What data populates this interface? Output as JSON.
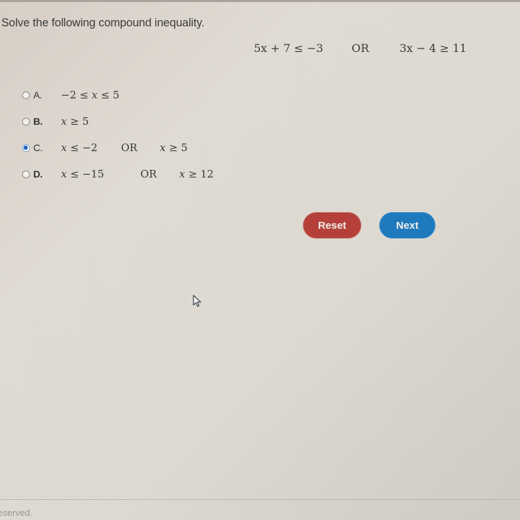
{
  "question": {
    "prompt": "Solve the following compound inequality.",
    "equation": {
      "left": "5x + 7 ≤ −3",
      "connector": "OR",
      "right": "3x − 4 ≥ 11"
    }
  },
  "options": [
    {
      "letter": "A.",
      "parts": [
        "−2 ≤ ",
        "x",
        " ≤ 5"
      ],
      "connector": "",
      "second": [],
      "selected": false
    },
    {
      "letter": "B.",
      "parts": [
        "",
        "x",
        " ≥ 5"
      ],
      "connector": "",
      "second": [],
      "selected": false
    },
    {
      "letter": "C.",
      "parts": [
        "",
        "x",
        " ≤ −2"
      ],
      "connector": "OR",
      "second": [
        "x",
        " ≥ 5"
      ],
      "selected": true
    },
    {
      "letter": "D.",
      "parts": [
        "",
        "x",
        " ≤ −15"
      ],
      "connector": "OR",
      "second": [
        "x",
        " ≥ 12"
      ],
      "selected": false
    }
  ],
  "buttons": {
    "reset_label": "Reset",
    "next_label": "Next"
  },
  "footer": {
    "text": "eserved."
  },
  "colors": {
    "reset": "#b5403a",
    "next": "#1f79bd",
    "selected_radio": "#1f5fc4"
  }
}
